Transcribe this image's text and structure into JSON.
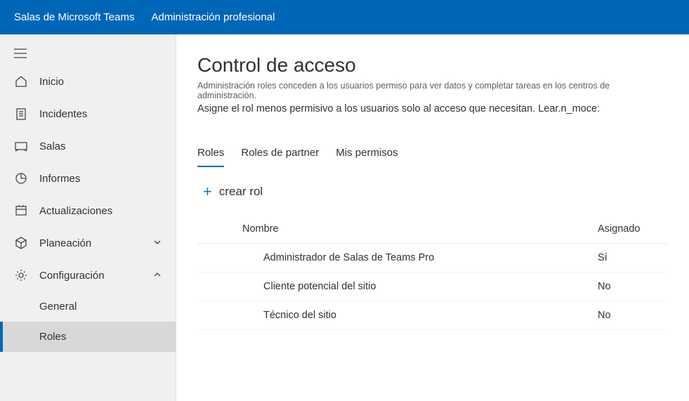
{
  "topbar": {
    "brand": "Salas de Microsoft Teams",
    "section": "Administración profesional"
  },
  "sidebar": {
    "items": [
      {
        "key": "inicio",
        "label": "Inicio"
      },
      {
        "key": "incidentes",
        "label": "Incidentes"
      },
      {
        "key": "salas",
        "label": "Salas"
      },
      {
        "key": "informes",
        "label": "Informes"
      },
      {
        "key": "actualizaciones",
        "label": "Actualizaciones"
      },
      {
        "key": "planeacion",
        "label": "Planeación"
      },
      {
        "key": "configuracion",
        "label": "Configuración"
      }
    ],
    "config_children": [
      {
        "key": "general",
        "label": "General"
      },
      {
        "key": "roles",
        "label": "Roles"
      }
    ]
  },
  "page": {
    "title": "Control de acceso",
    "desc1": "Administración roles conceden a los usuarios permiso para ver datos y completar tareas en los centros de administración.",
    "desc2": "Asigne el rol menos permisivo a los usuarios solo al acceso que necesitan. Lear.n_moce:"
  },
  "tabs": [
    {
      "key": "roles",
      "label": "Roles"
    },
    {
      "key": "partner",
      "label": "Roles de partner"
    },
    {
      "key": "mis-permisos",
      "label": "Mis permisos"
    }
  ],
  "create": {
    "label": "crear rol"
  },
  "table": {
    "headers": {
      "name": "Nombre",
      "assigned": "Asignado"
    },
    "rows": [
      {
        "name": "Administrador de Salas de Teams Pro",
        "assigned": "Sí"
      },
      {
        "name": "Cliente potencial del sitio",
        "assigned": "No"
      },
      {
        "name": "Técnico del sitio",
        "assigned": "No"
      }
    ]
  }
}
